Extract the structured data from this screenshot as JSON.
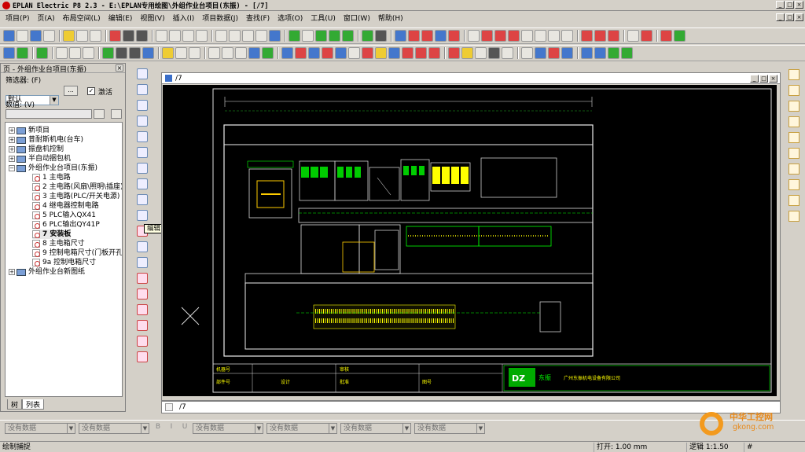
{
  "window": {
    "title": "EPLAN Electric P8 2.3 - E:\\EPLAN专用绘图\\外组作业台项目(东振) - [/7]",
    "min": "_",
    "max": "□",
    "close": "×"
  },
  "menu": [
    "项目(P)",
    "页(A)",
    "布局空间(L)",
    "编辑(E)",
    "视图(V)",
    "插入(I)",
    "项目数据(J)",
    "查找(F)",
    "选项(O)",
    "工具(U)",
    "窗口(W)",
    "帮助(H)"
  ],
  "navigator": {
    "title": "页 - 外组作业台项目(东振)",
    "filter_label": "筛选器: (F)",
    "filter_value": "默认",
    "browse_button": "...",
    "activate_label": "激活",
    "activate_checked": true,
    "value_label": "数值: (V)",
    "value_input": "",
    "tree": [
      {
        "label": "新项目",
        "level": 0,
        "expand": "+",
        "kind": "project"
      },
      {
        "label": "昔耐斯机电(台车)",
        "level": 0,
        "expand": "+",
        "kind": "project"
      },
      {
        "label": "振盘机控制",
        "level": 0,
        "expand": "+",
        "kind": "project"
      },
      {
        "label": "半自动捆包机",
        "level": 0,
        "expand": "+",
        "kind": "project"
      },
      {
        "label": "外组作业台项目(东振)",
        "level": 0,
        "expand": "−",
        "kind": "project"
      },
      {
        "label": "1 主电路",
        "level": 1,
        "kind": "page"
      },
      {
        "label": "2 主电路(风扇\\照明\\插座)",
        "level": 1,
        "kind": "page"
      },
      {
        "label": "3 主电路(PLC/开关电源)",
        "level": 1,
        "kind": "page"
      },
      {
        "label": "4 继电器控制电路",
        "level": 1,
        "kind": "page"
      },
      {
        "label": "5 PLC输入QX41",
        "level": 1,
        "kind": "page"
      },
      {
        "label": "6 PLC输出QY41P",
        "level": 1,
        "kind": "page"
      },
      {
        "label": "7 安装板",
        "level": 1,
        "kind": "page",
        "selected": true
      },
      {
        "label": "8 主电箱尺寸",
        "level": 1,
        "kind": "page"
      },
      {
        "label": "9 控制电箱尺寸(门板开孔)",
        "level": 1,
        "kind": "page"
      },
      {
        "label": "9a 控制电箱尺寸",
        "level": 1,
        "kind": "page"
      },
      {
        "label": "外组作业台新图纸",
        "level": 0,
        "expand": "+",
        "kind": "project"
      }
    ],
    "tabs": [
      "树",
      "列表"
    ],
    "active_tab": "列表"
  },
  "tooltip": "编辑 (E)",
  "document": {
    "page_name": "/7",
    "tab_label": "/7"
  },
  "titleblock": {
    "machine_no": "机器号",
    "part_no": "部件号",
    "design": "设计",
    "review": "审核",
    "approve": "批准",
    "drawing_no": "图号",
    "company_logo": "DZ",
    "company_short": "东振",
    "company_name": "广州东振机电设备有限公司"
  },
  "propbar": {
    "fields": [
      "没有数据",
      "没有数据",
      "没有数据",
      "没有数据",
      "没有数据",
      "没有数据"
    ],
    "format_buttons": [
      "B",
      "I",
      "U"
    ]
  },
  "status": {
    "left": "绘制捕捉",
    "open": "打开: 1.00 mm",
    "logic": "逻辑 1:1.50",
    "hash": "#"
  },
  "watermark": {
    "title": "中华工控网",
    "url": "gkong.com"
  }
}
